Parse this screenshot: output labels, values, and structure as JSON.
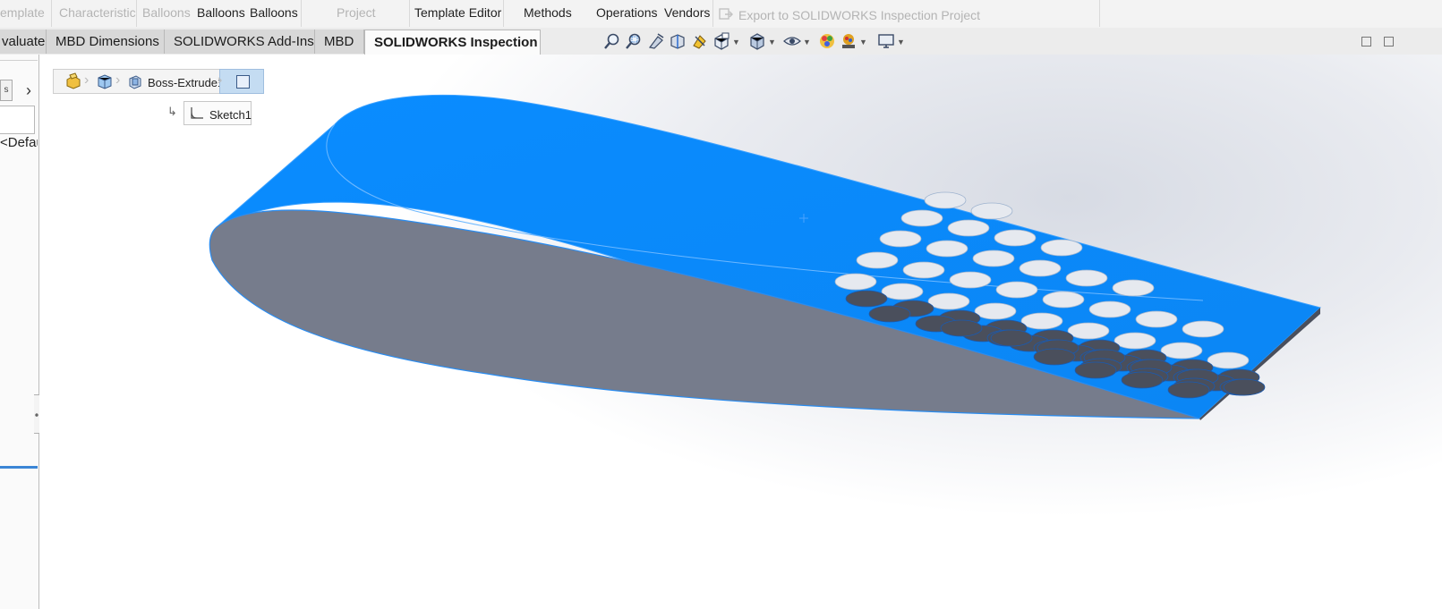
{
  "ribbon": {
    "template": "emplate",
    "characteristic": "Characteristic",
    "balloons_dim": "Balloons",
    "balloons_1": "Balloons",
    "balloons_2": "Balloons",
    "project": "Project",
    "template_editor": "Template Editor",
    "methods": "Methods",
    "operations": "Operations",
    "vendors": "Vendors",
    "export": "Export to SOLIDWORKS Inspection Project"
  },
  "tabs": [
    {
      "label": "valuate",
      "active": false
    },
    {
      "label": "MBD Dimensions",
      "active": false
    },
    {
      "label": "SOLIDWORKS Add-Ins",
      "active": false
    },
    {
      "label": "MBD",
      "active": false
    },
    {
      "label": "SOLIDWORKS Inspection",
      "active": true
    }
  ],
  "heads_up_toolbar": [
    "zoom-to-fit-icon",
    "zoom-to-area-icon",
    "previous-view-icon",
    "section-view-icon",
    "dynamic-annotation-icon",
    "view-orientation-icon",
    "display-style-icon",
    "hide-show-items-icon",
    "edit-appearance-icon",
    "apply-scene-icon",
    "view-settings-icon"
  ],
  "left_panel": {
    "button_left": "s",
    "arrow": "›",
    "config_text": "<Default"
  },
  "breadcrumb": {
    "feature": "Boss-Extrude1",
    "sketch": "Sketch1"
  },
  "colors": {
    "accent": "#0a8cff",
    "face_gray": "#767c8c",
    "hole_light": "#e6e9ef",
    "hole_dark": "#4a4f5c"
  }
}
